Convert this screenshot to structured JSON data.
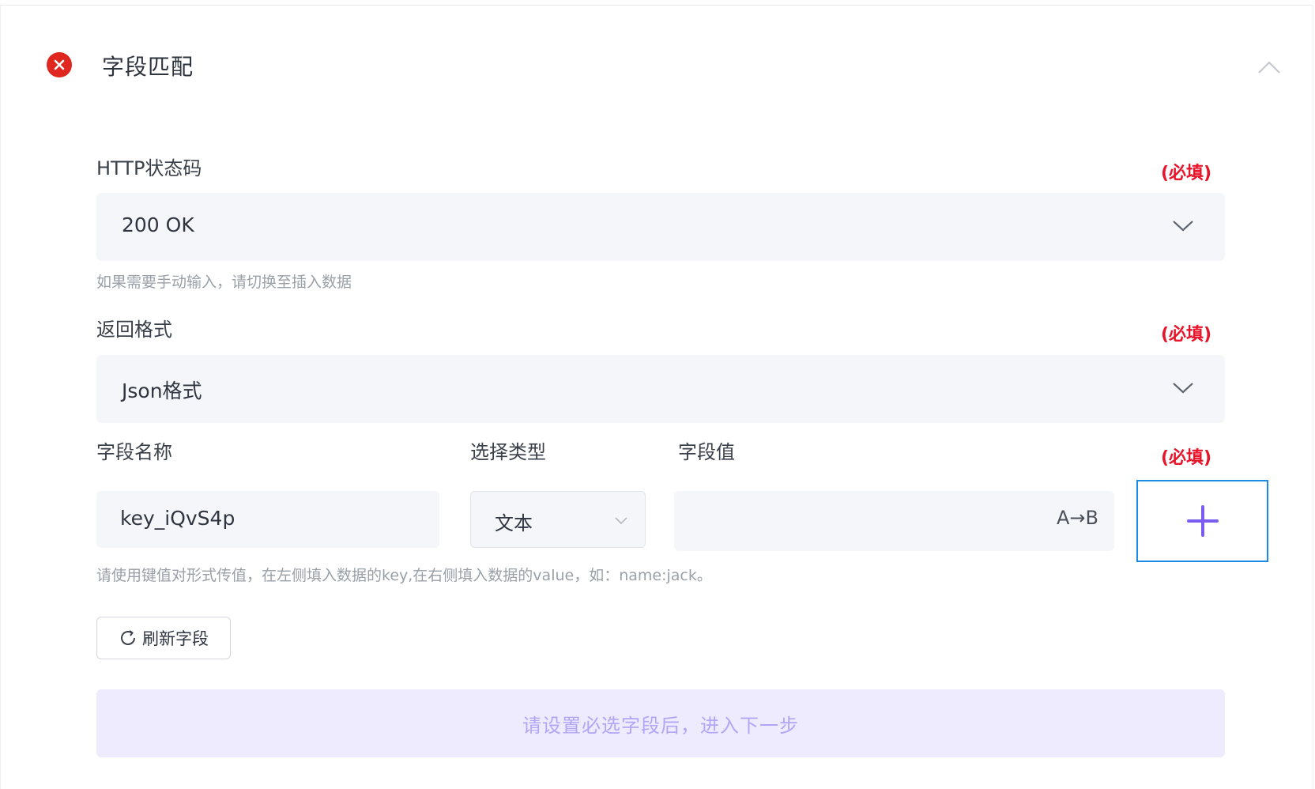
{
  "header": {
    "title": "字段匹配",
    "status_icon": "error-circle-icon",
    "collapse_icon": "chevron-up-icon"
  },
  "http_status": {
    "label": "HTTP状态码",
    "required": "(必填)",
    "value": "200 OK",
    "hint": "如果需要手动输入，请切换至插入数据"
  },
  "return_format": {
    "label": "返回格式",
    "required": "(必填)",
    "value": "Json格式"
  },
  "fields": {
    "name_label": "字段名称",
    "type_label": "选择类型",
    "value_label": "字段值",
    "required": "(必填)",
    "name_value": "key_iQvS4p",
    "type_value": "文本",
    "value_value": "",
    "value_toggle": "A→B",
    "hint": "请使用键值对形式传值，在左侧填入数据的key,在右侧填入数据的value，如：name:jack。"
  },
  "refresh_button": {
    "label": "刷新字段"
  },
  "next_button": {
    "label": "请设置必选字段后，进入下一步"
  },
  "colors": {
    "error": "#e0271f",
    "required": "#e8152a",
    "accent": "#7a5cf0",
    "focus_border": "#1a8ae6",
    "disabled_button_bg": "#efebff"
  }
}
